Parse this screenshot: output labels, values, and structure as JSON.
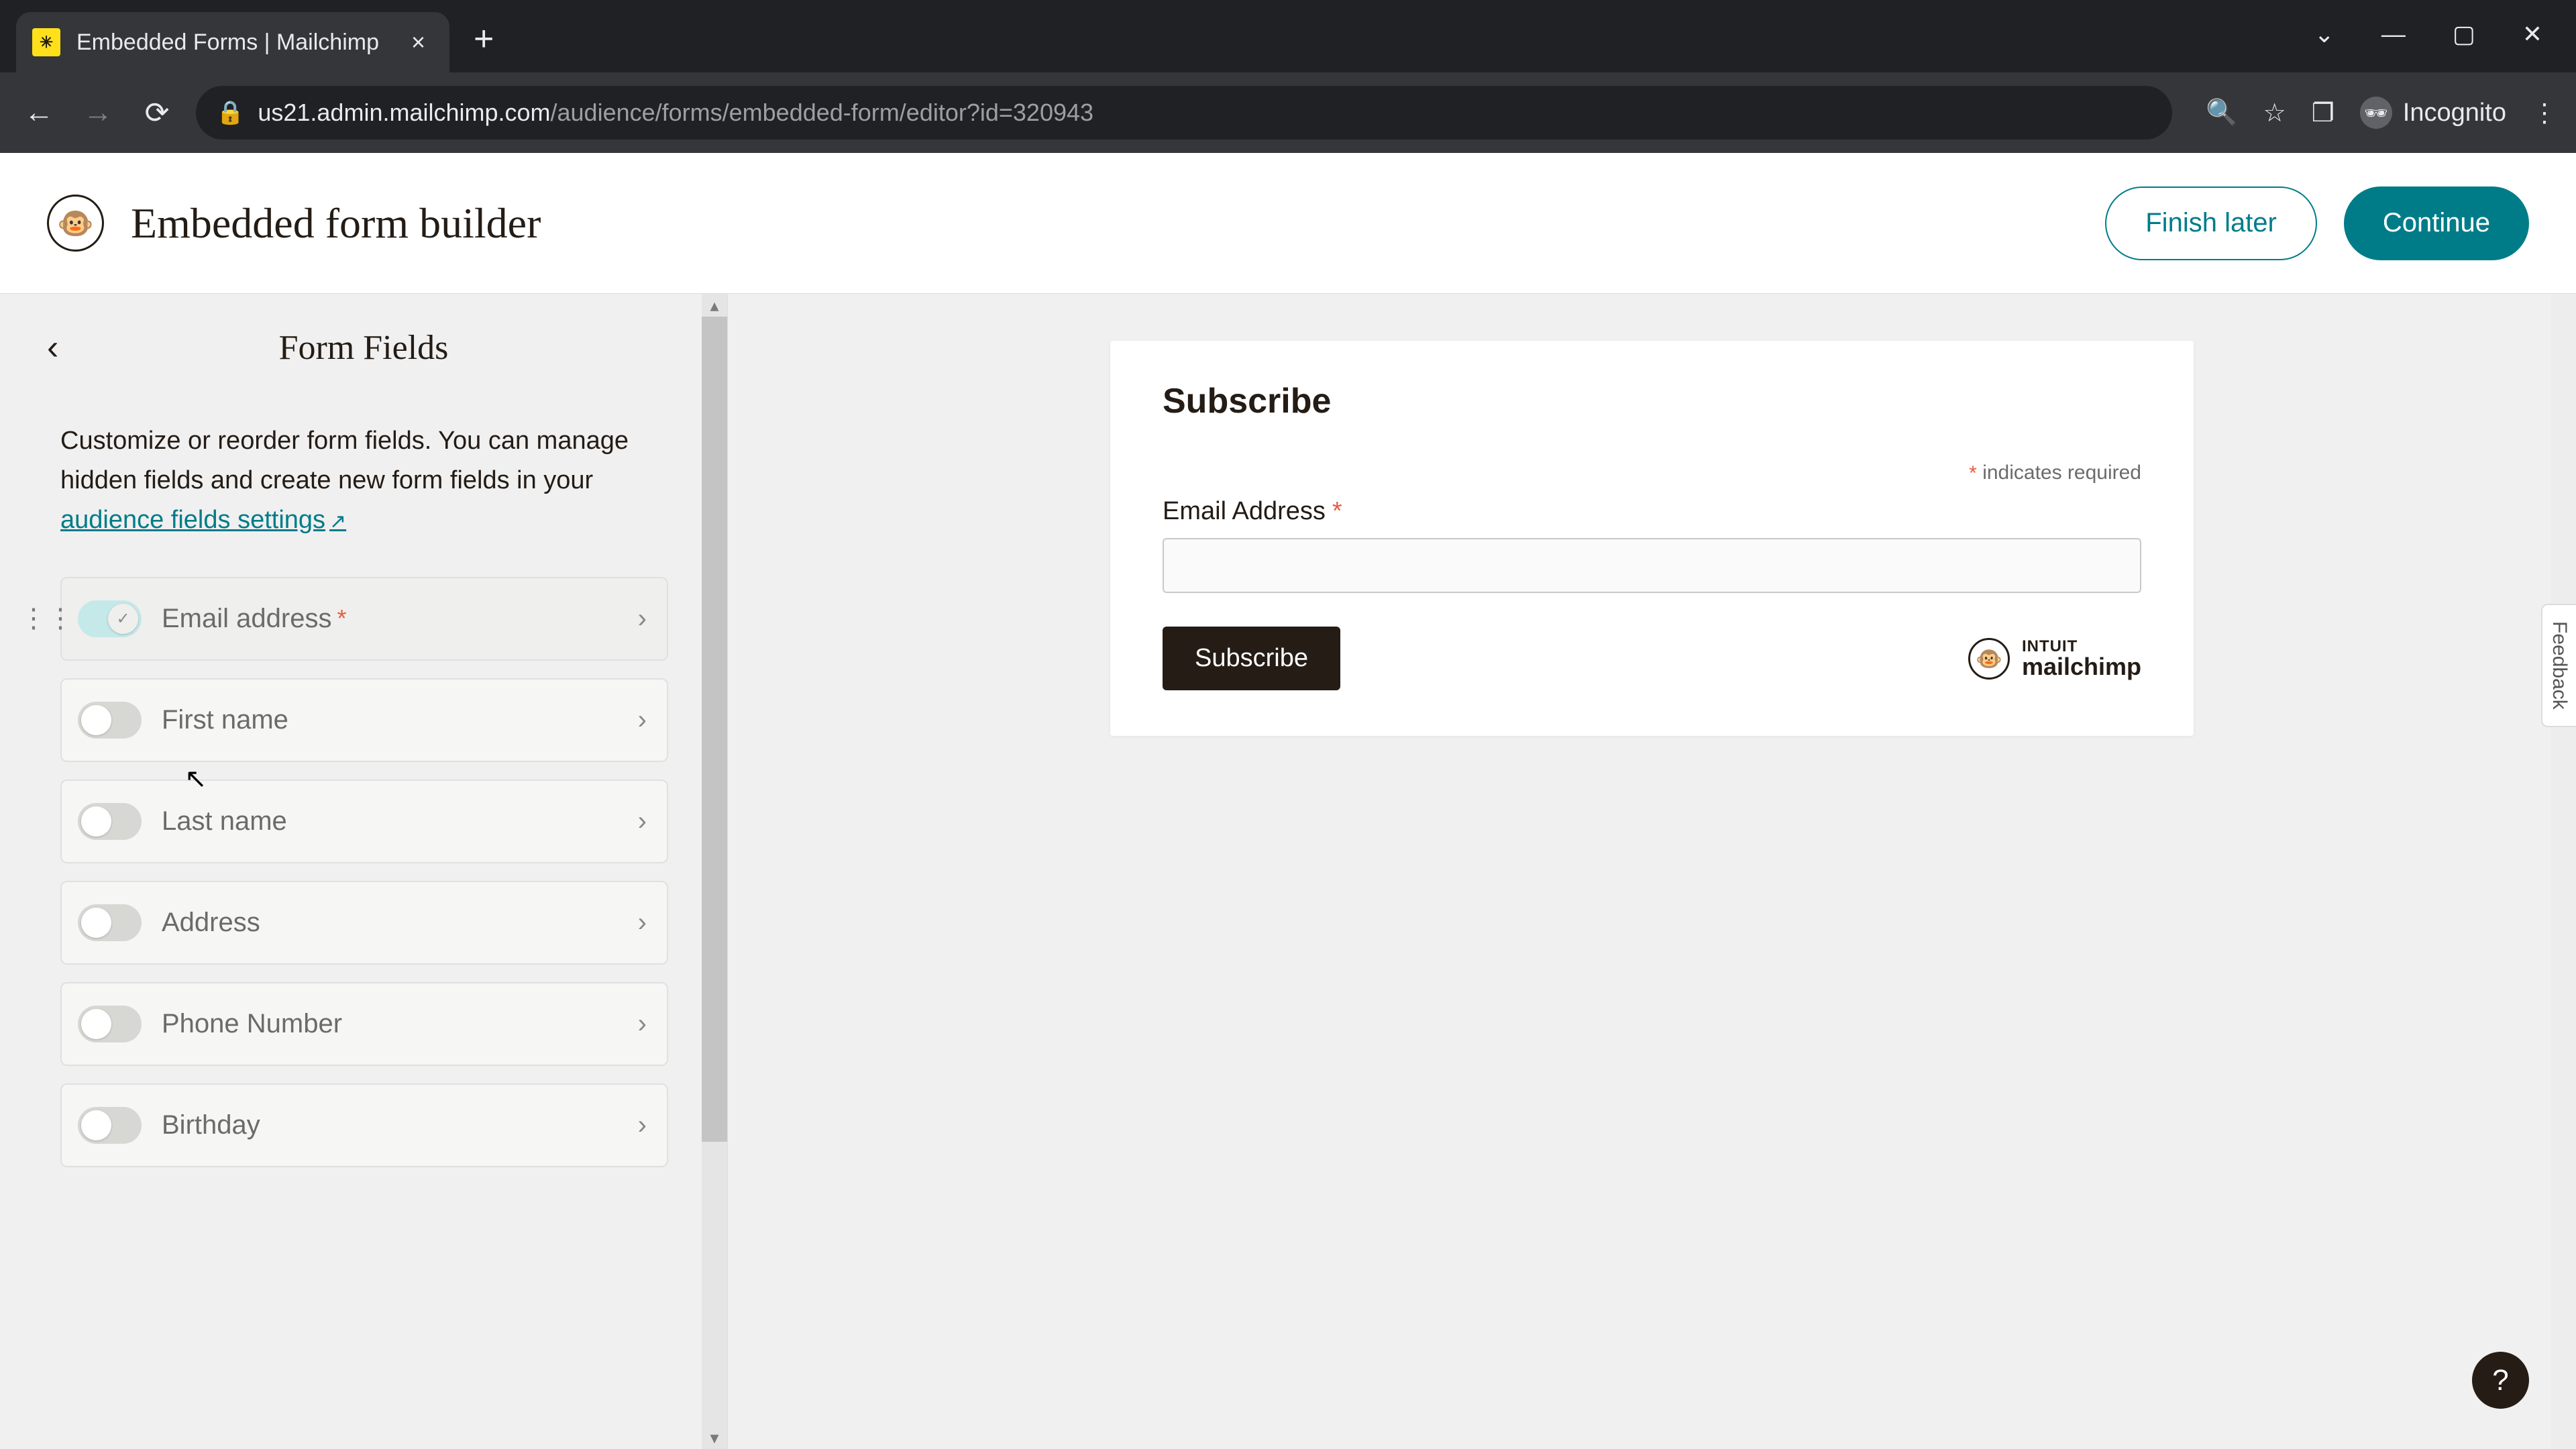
{
  "browser": {
    "tab_title": "Embedded Forms | Mailchimp",
    "url_host": "us21.admin.mailchimp.com",
    "url_path": "/audience/forms/embedded-form/editor?id=320943",
    "incognito_label": "Incognito"
  },
  "header": {
    "title": "Embedded form builder",
    "finish_label": "Finish later",
    "continue_label": "Continue"
  },
  "sidebar": {
    "title": "Form Fields",
    "description_pre": "Customize or reorder form fields. You can manage hidden fields and create new form fields in your ",
    "link_text": "audience fields settings",
    "fields": [
      {
        "label": "Email address",
        "required": true,
        "on": true,
        "locked": true
      },
      {
        "label": "First name",
        "required": false,
        "on": false,
        "locked": false
      },
      {
        "label": "Last name",
        "required": false,
        "on": false,
        "locked": false
      },
      {
        "label": "Address",
        "required": false,
        "on": false,
        "locked": false
      },
      {
        "label": "Phone Number",
        "required": false,
        "on": false,
        "locked": false
      },
      {
        "label": "Birthday",
        "required": false,
        "on": false,
        "locked": false
      }
    ]
  },
  "preview": {
    "title": "Subscribe",
    "required_note": "indicates required",
    "email_label": "Email Address",
    "subscribe_label": "Subscribe",
    "brand_line1": "INTUIT",
    "brand_line2": "mailchimp"
  },
  "feedback_label": "Feedback"
}
